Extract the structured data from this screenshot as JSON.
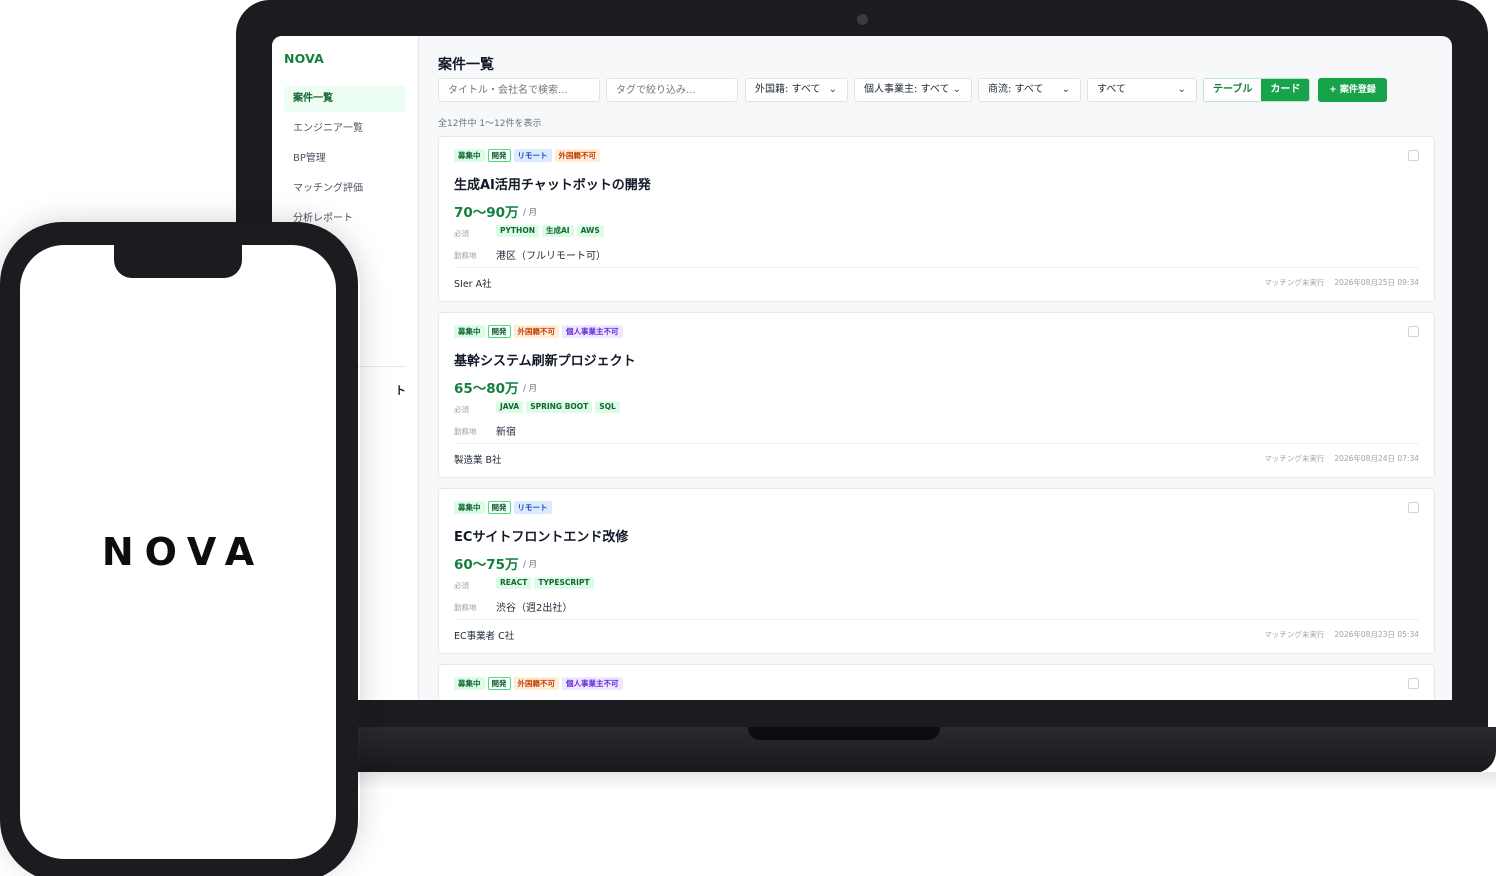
{
  "app": {
    "name": "NOVA"
  },
  "sidebar": {
    "items": [
      {
        "label": "案件一覧",
        "active": true
      },
      {
        "label": "エンジニア一覧"
      },
      {
        "label": "BP管理"
      },
      {
        "label": "マッチング評価"
      },
      {
        "label": "分析レポート"
      }
    ],
    "logout_partial": "ト"
  },
  "page": {
    "title": "案件一覧",
    "count_text": "全12件中 1〜12件を表示"
  },
  "filters": {
    "search_placeholder": "タイトル・会社名で検索...",
    "tag_placeholder": "タグで絞り込み...",
    "foreign": "外国籍: すべて",
    "sole": "個人事業主: すべて",
    "commerce": "商流: すべて",
    "status": "すべて"
  },
  "view_toggle": {
    "table": "テーブル",
    "card": "カード",
    "selected": "カード"
  },
  "new_button": "+ 案件登録",
  "labels": {
    "required": "必須",
    "location": "勤務地",
    "unit": "/ 月"
  },
  "jobs": [
    {
      "tags": [
        {
          "text": "募集中",
          "kind": "recruit"
        },
        {
          "text": "開発",
          "kind": "dev"
        },
        {
          "text": "リモート",
          "kind": "remote"
        },
        {
          "text": "外国籍不可",
          "kind": "foreign"
        }
      ],
      "title": "生成AI活用チャットボットの開発",
      "price": "70〜90万",
      "skills": [
        "PYTHON",
        "生成AI",
        "AWS"
      ],
      "location": "港区（フルリモート可）",
      "company": "SIer A社",
      "matching": "マッチング未実行",
      "date": "2026年08月25日 09:34"
    },
    {
      "tags": [
        {
          "text": "募集中",
          "kind": "recruit"
        },
        {
          "text": "開発",
          "kind": "dev"
        },
        {
          "text": "外国籍不可",
          "kind": "foreign"
        },
        {
          "text": "個人事業主不可",
          "kind": "sole"
        }
      ],
      "title": "基幹システム刷新プロジェクト",
      "price": "65〜80万",
      "skills": [
        "JAVA",
        "SPRING BOOT",
        "SQL"
      ],
      "location": "新宿",
      "company": "製造業 B社",
      "matching": "マッチング未実行",
      "date": "2026年08月24日 07:34"
    },
    {
      "tags": [
        {
          "text": "募集中",
          "kind": "recruit"
        },
        {
          "text": "開発",
          "kind": "dev"
        },
        {
          "text": "リモート",
          "kind": "remote"
        }
      ],
      "title": "ECサイトフロントエンド改修",
      "price": "60〜75万",
      "skills": [
        "REACT",
        "TYPESCRIPT"
      ],
      "location": "渋谷（週2出社）",
      "company": "EC事業者 C社",
      "matching": "マッチング未実行",
      "date": "2026年08月23日 05:34"
    },
    {
      "tags": [
        {
          "text": "募集中",
          "kind": "recruit"
        },
        {
          "text": "開発",
          "kind": "dev"
        },
        {
          "text": "外国籍不可",
          "kind": "foreign"
        },
        {
          "text": "個人事業主不可",
          "kind": "sole"
        }
      ]
    }
  ],
  "phone": {
    "logo": "NOVA"
  }
}
